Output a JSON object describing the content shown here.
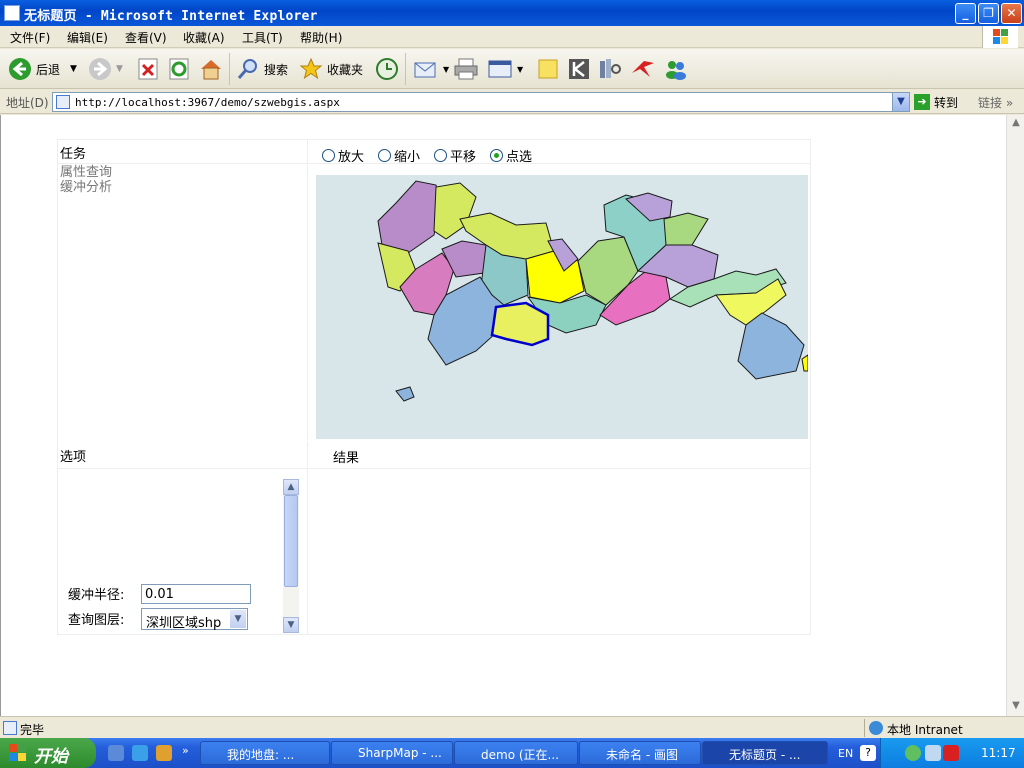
{
  "window": {
    "title": "无标题页 - Microsoft Internet Explorer",
    "min": "_",
    "max": "❐",
    "close": "✕"
  },
  "menu": [
    "文件(F)",
    "编辑(E)",
    "查看(V)",
    "收藏(A)",
    "工具(T)",
    "帮助(H)"
  ],
  "toolbar": {
    "back": "后退",
    "search": "搜索",
    "favorites": "收藏夹"
  },
  "address": {
    "label": "地址(D)",
    "url": "http://localhost:3967/demo/szwebgis.aspx",
    "go": "转到",
    "links": "链接"
  },
  "page": {
    "task_header": "任务",
    "tasks": [
      "属性查询",
      "缓冲分析"
    ],
    "tools": [
      {
        "label": "放大",
        "checked": false
      },
      {
        "label": "缩小",
        "checked": false
      },
      {
        "label": "平移",
        "checked": false
      },
      {
        "label": "点选",
        "checked": true
      }
    ],
    "options_header": "选项",
    "results_header": "结果",
    "buffer_label": "缓冲半径:",
    "buffer_value": "0.01",
    "layer_label": "查询图层:",
    "layer_value": "深圳区域shp"
  },
  "status": {
    "text": "完毕",
    "zone": "本地 Intranet"
  },
  "taskbar": {
    "start": "开始",
    "buttons": [
      "我的地盘: ...",
      "SharpMap - ...",
      "demo (正在...",
      "未命名 - 画图",
      "无标题页 - ..."
    ],
    "active_index": 4,
    "lang": "EN",
    "clock": "11:17"
  },
  "colors": {
    "map_bg": "#d8e6ea",
    "selected_outline": "#0000cc"
  }
}
